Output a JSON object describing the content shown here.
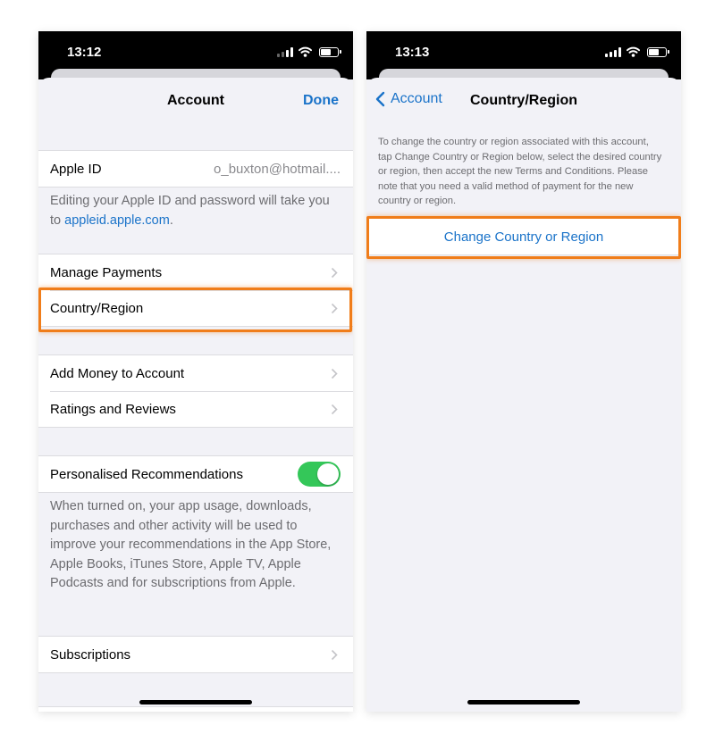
{
  "left": {
    "status": {
      "time": "13:12"
    },
    "nav": {
      "title": "Account",
      "done": "Done"
    },
    "apple_id": {
      "label": "Apple ID",
      "value": "o_buxton@hotmail...."
    },
    "apple_id_note": {
      "prefix": "Editing your Apple ID and password will take you to ",
      "link": "appleid.apple.com",
      "suffix": "."
    },
    "menu1": [
      {
        "label": "Manage Payments"
      },
      {
        "label": "Country/Region"
      }
    ],
    "menu2": [
      {
        "label": "Add Money to Account"
      },
      {
        "label": "Ratings and Reviews"
      }
    ],
    "personalised": {
      "label": "Personalised Recommendations",
      "toggle_on": true,
      "note": "When turned on, your app usage, downloads, purchases and other activity will be used to improve your recommendations in the App Store, Apple Books, iTunes Store, Apple TV, Apple Podcasts and for subscriptions from Apple."
    },
    "subscriptions": {
      "label": "Subscriptions"
    }
  },
  "right": {
    "status": {
      "time": "13:13"
    },
    "nav": {
      "back": "Account",
      "title": "Country/Region"
    },
    "info": "To change the country or region associated with this account, tap Change Country or Region below, select the desired country or region, then accept the new Terms and Conditions. Please note that you need a valid method of payment for the new country or region.",
    "button": "Change Country or Region"
  },
  "icons": [
    "signal-icon",
    "wifi-icon",
    "battery-icon",
    "chevron-right-icon",
    "chevron-left-icon"
  ],
  "colors": {
    "accent": "#1a73c9",
    "highlight": "#f07d1a",
    "toggle": "#34c759"
  }
}
